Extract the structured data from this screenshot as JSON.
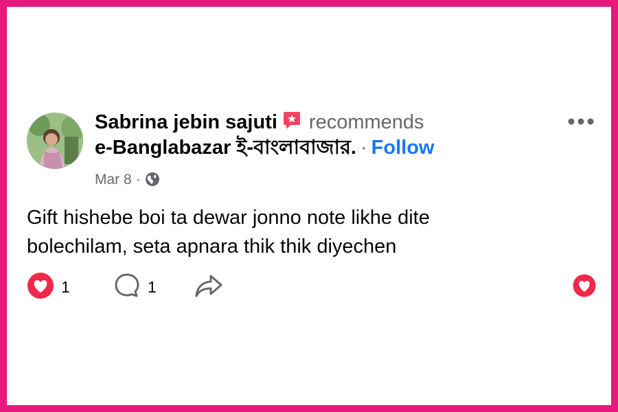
{
  "post": {
    "author_name": "Sabrina jebin sajuti",
    "recommends_text": "recommends",
    "page_name": "e-Banglabazar ই-বাংলাবাজার.",
    "separator": "·",
    "follow_label": "Follow",
    "date": "Mar 8",
    "meta_separator": "·",
    "body_text": "Gift hishebe boi ta dewar jonno note likhe dite bolechilam, seta apnara thik thik diyechen"
  },
  "actions": {
    "reactions_count": "1",
    "comments_count": "1"
  },
  "icons": {
    "badge": "recommend-badge-icon",
    "globe": "globe-icon",
    "more": "more-options-icon",
    "heart": "heart-reaction-icon",
    "comment": "comment-icon",
    "share": "share-icon"
  },
  "colors": {
    "frame": "#e8197c",
    "follow": "#1877f2",
    "heart": "#f0284a",
    "secondary_text": "#65676b",
    "badge": "#f3425f"
  }
}
